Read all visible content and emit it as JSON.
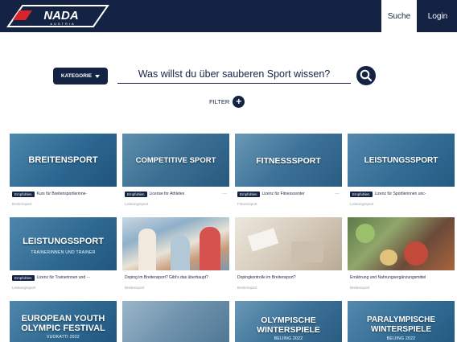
{
  "header": {
    "logo_text": "NADA",
    "logo_subtext": "AUSTRIA",
    "nav_search": "Suche",
    "nav_login": "Login"
  },
  "search": {
    "category_label": "KATEGORIE",
    "prompt": "Was willst du über sauberen Sport wissen?",
    "filter_label": "FILTER",
    "filter_icon": "plus-icon"
  },
  "cards": [
    {
      "title": "BREITENSPORT",
      "subtitle": "",
      "badge": "Empfohlen",
      "text": "Kurs für Breitensportlerinne-",
      "category": "Breitensport",
      "dots": ""
    },
    {
      "title": "COMPETITIVE SPORT",
      "subtitle": "",
      "badge": "Empfohlen",
      "text": "License for Athletes",
      "category": "Leistungssport",
      "dots": "···"
    },
    {
      "title": "FITNESSSPORT",
      "subtitle": "",
      "badge": "Empfohlen",
      "text": "Lizenz für Fitnesscenter",
      "category": "Fitnesssport",
      "dots": "···"
    },
    {
      "title": "LEISTUNGSSPORT",
      "subtitle": "",
      "badge": "Empfohlen",
      "text": "Lizenz für Sportlerinnen unc-",
      "category": "Leistungssport",
      "dots": ""
    },
    {
      "title": "LEISTUNGSSPORT",
      "subtitle": "TRAINERINNEN UND TRAINER",
      "badge": "Empfohlen",
      "text": "Lizenz für Trainerinnen und ···",
      "category": "Leistungssport",
      "dots": ""
    },
    {
      "title": "",
      "subtitle": "",
      "badge": "",
      "text": "Doping im Breitensport? Gibt's das überhaupt?",
      "category": "Breitensport",
      "dots": ""
    },
    {
      "title": "",
      "subtitle": "",
      "badge": "",
      "text": "Dopingkontrolle im Breitensport?",
      "category": "Breitensport",
      "dots": ""
    },
    {
      "title": "",
      "subtitle": "",
      "badge": "",
      "text": "Ernährung und Nahrungsergänzungsmittel",
      "category": "Breitensport",
      "dots": ""
    },
    {
      "title": "EUROPEAN YOUTH OLYMPIC FESTIVAL",
      "subtitle": "VUOKATTI 2022",
      "badge": "",
      "text": "",
      "category": "",
      "dots": ""
    },
    {
      "title": "",
      "subtitle": "",
      "badge": "",
      "text": "",
      "category": "",
      "dots": ""
    },
    {
      "title": "OLYMPISCHE WINTERSPIELE",
      "subtitle": "BEIJING 2022",
      "badge": "",
      "text": "",
      "category": "",
      "dots": ""
    },
    {
      "title": "PARALYMPISCHE WINTERSPIELE",
      "subtitle": "BEIJING 2022",
      "badge": "",
      "text": "",
      "category": "",
      "dots": ""
    }
  ],
  "colors": {
    "navy": "#142344",
    "card_blue": "#2f6f98",
    "muted_text": "#9aa0ae"
  }
}
